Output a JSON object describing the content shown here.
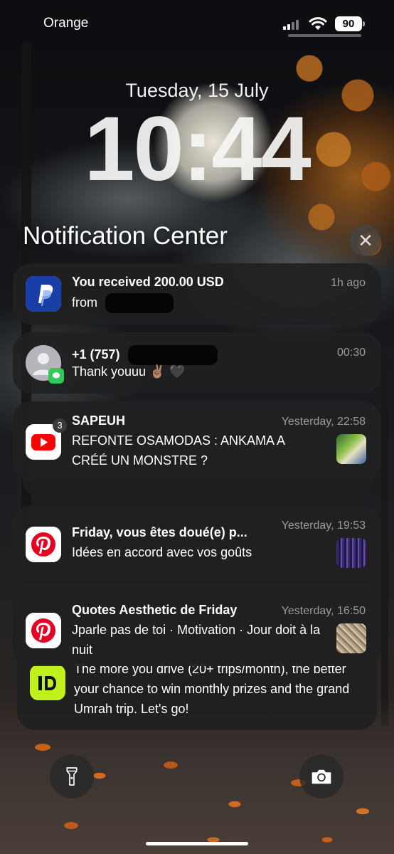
{
  "status_bar": {
    "carrier": "Orange",
    "battery_level": "90",
    "signal_icon": "signal-bars-icon",
    "wifi_icon": "wifi-icon"
  },
  "lock_screen": {
    "date": "Tuesday, 15 July",
    "time": "10:44"
  },
  "notification_center": {
    "title": "Notification Center",
    "close_icon": "close-icon"
  },
  "notifications": [
    {
      "app": "PayPal",
      "title": "You received 200.00 USD",
      "time": "1h ago",
      "body": "from",
      "icon": "paypal-icon",
      "accent": "#003087"
    },
    {
      "app": "Messages",
      "title": "+1 (757)",
      "time": "00:30",
      "body": "Thank youuu ✌🏽 🖤",
      "icon": "contact-avatar-icon",
      "badge_icon": "messages-icon",
      "accent": "#34C759"
    },
    {
      "app": "YouTube",
      "title": "SAPEUH",
      "time": "Yesterday, 22:58",
      "body": "REFONTE OSAMODAS : ANKAMA A CRÉÉ UN MONSTRE ?",
      "icon": "youtube-icon",
      "count": "3",
      "accent": "#FF0000"
    },
    {
      "app": "Pinterest",
      "title": "Friday, vous êtes doué(e) p...",
      "time": "Yesterday, 19:53",
      "body": "Idées en accord avec vos goûts",
      "icon": "pinterest-icon",
      "accent": "#E60023"
    },
    {
      "app": "Pinterest",
      "title": "Quotes Aesthetic de Friday",
      "time": "Yesterday, 16:50",
      "body": "Jparle pas de toi · Motivation · Jour doit à la nuit",
      "icon": "pinterest-icon",
      "accent": "#E60023"
    },
    {
      "app": "inDrive",
      "title": "",
      "time": "",
      "body": "The more you drive (20+ trips/month), the better your chance to win monthly prizes and the grand Umrah trip. Let's go!",
      "icon": "indrive-icon",
      "accent": "#C1F11D"
    }
  ],
  "bottom_controls": {
    "left_icon": "flashlight-icon",
    "right_icon": "camera-icon"
  }
}
